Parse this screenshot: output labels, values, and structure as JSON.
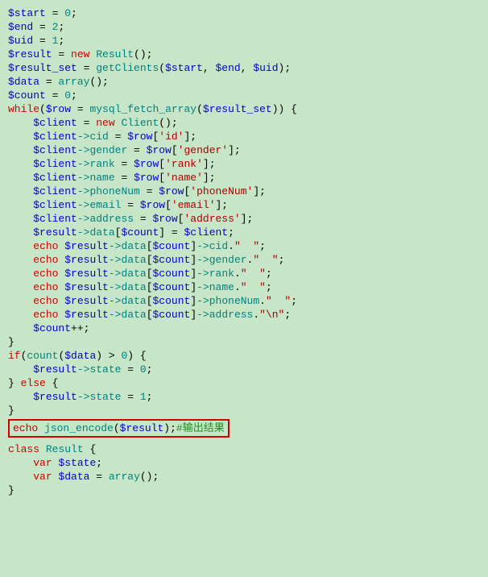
{
  "code": {
    "l1_var": "$start",
    "l1_eq": " = ",
    "l1_val": "0",
    "l1_sc": ";",
    "l2_var": "$end",
    "l2_eq": " = ",
    "l2_val": "2",
    "l2_sc": ";",
    "l3_var": "$uid",
    "l3_eq": " = ",
    "l3_val": "1",
    "l3_sc": ";",
    "l4_var": "$result",
    "l4_eq": " = ",
    "l4_new": "new",
    "l4_cls": " Result",
    "l4_rest": "();",
    "l5_var": "$result_set",
    "l5_eq": " = ",
    "l5_fn": "getClients",
    "l5_op": "(",
    "l5_a1": "$start",
    "l5_c1": ", ",
    "l5_a2": "$end",
    "l5_c2": ", ",
    "l5_a3": "$uid",
    "l5_cl": ");",
    "l6_var": "$data",
    "l6_eq": " = ",
    "l6_fn": "array",
    "l6_rest": "();",
    "l7_var": "$count",
    "l7_eq": " = ",
    "l7_val": "0",
    "l7_sc": ";",
    "blank": "",
    "l8_kw": "while",
    "l8_op": "(",
    "l8_row": "$row",
    "l8_eq": " = ",
    "l8_fn": "mysql_fetch_array",
    "l8_op2": "(",
    "l8_rs": "$result_set",
    "l8_cl": ")) {",
    "l9_ind": "    ",
    "l9_var": "$client",
    "l9_eq": " = ",
    "l9_new": "new",
    "l9_cls": " Client",
    "l9_rest": "();",
    "l10_ind": "    ",
    "l10_var": "$client",
    "l10_arr": "->",
    "l10_prop": "cid",
    "l10_eq": " = ",
    "l10_row": "$row",
    "l10_br": "[",
    "l10_key": "'id'",
    "l10_cl": "];",
    "l11_ind": "    ",
    "l11_var": "$client",
    "l11_arr": "->",
    "l11_prop": "gender",
    "l11_eq": " = ",
    "l11_row": "$row",
    "l11_br": "[",
    "l11_key": "'gender'",
    "l11_cl": "];",
    "l12_ind": "    ",
    "l12_var": "$client",
    "l12_arr": "->",
    "l12_prop": "rank",
    "l12_eq": " = ",
    "l12_row": "$row",
    "l12_br": "[",
    "l12_key": "'rank'",
    "l12_cl": "];",
    "l13_ind": "    ",
    "l13_var": "$client",
    "l13_arr": "->",
    "l13_prop": "name",
    "l13_eq": " = ",
    "l13_row": "$row",
    "l13_br": "[",
    "l13_key": "'name'",
    "l13_cl": "];",
    "l14_ind": "    ",
    "l14_var": "$client",
    "l14_arr": "->",
    "l14_prop": "phoneNum",
    "l14_eq": " = ",
    "l14_row": "$row",
    "l14_br": "[",
    "l14_key": "'phoneNum'",
    "l14_cl": "];",
    "l15_ind": "    ",
    "l15_var": "$client",
    "l15_arr": "->",
    "l15_prop": "email",
    "l15_eq": " = ",
    "l15_row": "$row",
    "l15_br": "[",
    "l15_key": "'email'",
    "l15_cl": "];",
    "l16_ind": "    ",
    "l16_var": "$client",
    "l16_arr": "->",
    "l16_prop": "address",
    "l16_eq": " = ",
    "l16_row": "$row",
    "l16_br": "[",
    "l16_key": "'address'",
    "l16_cl": "];",
    "l17_ind": "    ",
    "l17_var": "$result",
    "l17_arr": "->",
    "l17_prop": "data",
    "l17_br": "[",
    "l17_cnt": "$count",
    "l17_cl": "] = ",
    "l17_cli": "$client",
    "l17_sc": ";",
    "l18_ind": "    ",
    "l18_kw": "echo",
    "l18_sp": " ",
    "l18_var": "$result",
    "l18_arr": "->",
    "l18_prop": "data",
    "l18_br": "[",
    "l18_cnt": "$count",
    "l18_cl": "]",
    "l18_arr2": "->",
    "l18_prop2": "cid",
    "l18_dot": ".",
    "l18_str": "\"  \"",
    "l18_sc": ";",
    "l19_ind": "    ",
    "l19_kw": "echo",
    "l19_sp": " ",
    "l19_var": "$result",
    "l19_arr": "->",
    "l19_prop": "data",
    "l19_br": "[",
    "l19_cnt": "$count",
    "l19_cl": "]",
    "l19_arr2": "->",
    "l19_prop2": "gender",
    "l19_dot": ".",
    "l19_str": "\"  \"",
    "l19_sc": ";",
    "l20_ind": "    ",
    "l20_kw": "echo",
    "l20_sp": " ",
    "l20_var": "$result",
    "l20_arr": "->",
    "l20_prop": "data",
    "l20_br": "[",
    "l20_cnt": "$count",
    "l20_cl": "]",
    "l20_arr2": "->",
    "l20_prop2": "rank",
    "l20_dot": ".",
    "l20_str": "\"  \"",
    "l20_sc": ";",
    "l21_ind": "    ",
    "l21_kw": "echo",
    "l21_sp": " ",
    "l21_var": "$result",
    "l21_arr": "->",
    "l21_prop": "data",
    "l21_br": "[",
    "l21_cnt": "$count",
    "l21_cl": "]",
    "l21_arr2": "->",
    "l21_prop2": "name",
    "l21_dot": ".",
    "l21_str": "\"  \"",
    "l21_sc": ";",
    "l22_ind": "    ",
    "l22_kw": "echo",
    "l22_sp": " ",
    "l22_var": "$result",
    "l22_arr": "->",
    "l22_prop": "data",
    "l22_br": "[",
    "l22_cnt": "$count",
    "l22_cl": "]",
    "l22_arr2": "->",
    "l22_prop2": "phoneNum",
    "l22_dot": ".",
    "l22_str": "\"  \"",
    "l22_sc": ";",
    "l23_ind": "    ",
    "l23_kw": "echo",
    "l23_sp": " ",
    "l23_var": "$result",
    "l23_arr": "->",
    "l23_prop": "data",
    "l23_br": "[",
    "l23_cnt": "$count",
    "l23_cl": "]",
    "l23_arr2": "->",
    "l23_prop2": "address",
    "l23_dot": ".",
    "l23_str": "\"\\n\"",
    "l23_sc": ";",
    "l24_ind": "    ",
    "l24_var": "$count",
    "l24_inc": "++;",
    "l25": "}",
    "l26_kw": "if",
    "l26_op": "(",
    "l26_fn": "count",
    "l26_op2": "(",
    "l26_var": "$data",
    "l26_cl": ") > ",
    "l26_val": "0",
    "l26_cl2": ") {",
    "l27_ind": "    ",
    "l27_var": "$result",
    "l27_arr": "->",
    "l27_prop": "state",
    "l27_eq": " = ",
    "l27_val": "0",
    "l27_sc": ";",
    "l28_a": "} ",
    "l28_kw": "else",
    "l28_b": " {",
    "l29_ind": "    ",
    "l29_var": "$result",
    "l29_arr": "->",
    "l29_prop": "state",
    "l29_eq": " = ",
    "l29_val": "1",
    "l29_sc": ";",
    "l30": "}",
    "hl_kw": "echo",
    "hl_sp": " ",
    "hl_fn": "json_encode",
    "hl_op": "(",
    "hl_var": "$result",
    "hl_cl": ");",
    "hl_cmt": "#输出结果",
    "l31_kw": "class",
    "l31_name": " Result ",
    "l31_br": "{",
    "l32_ind": "    ",
    "l32_kw": "var",
    "l32_sp": " ",
    "l32_var": "$state",
    "l32_sc": ";",
    "l33_ind": "    ",
    "l33_kw": "var",
    "l33_sp": " ",
    "l33_var": "$data",
    "l33_eq": " = ",
    "l33_fn": "array",
    "l33_rest": "();",
    "l34": "}"
  }
}
